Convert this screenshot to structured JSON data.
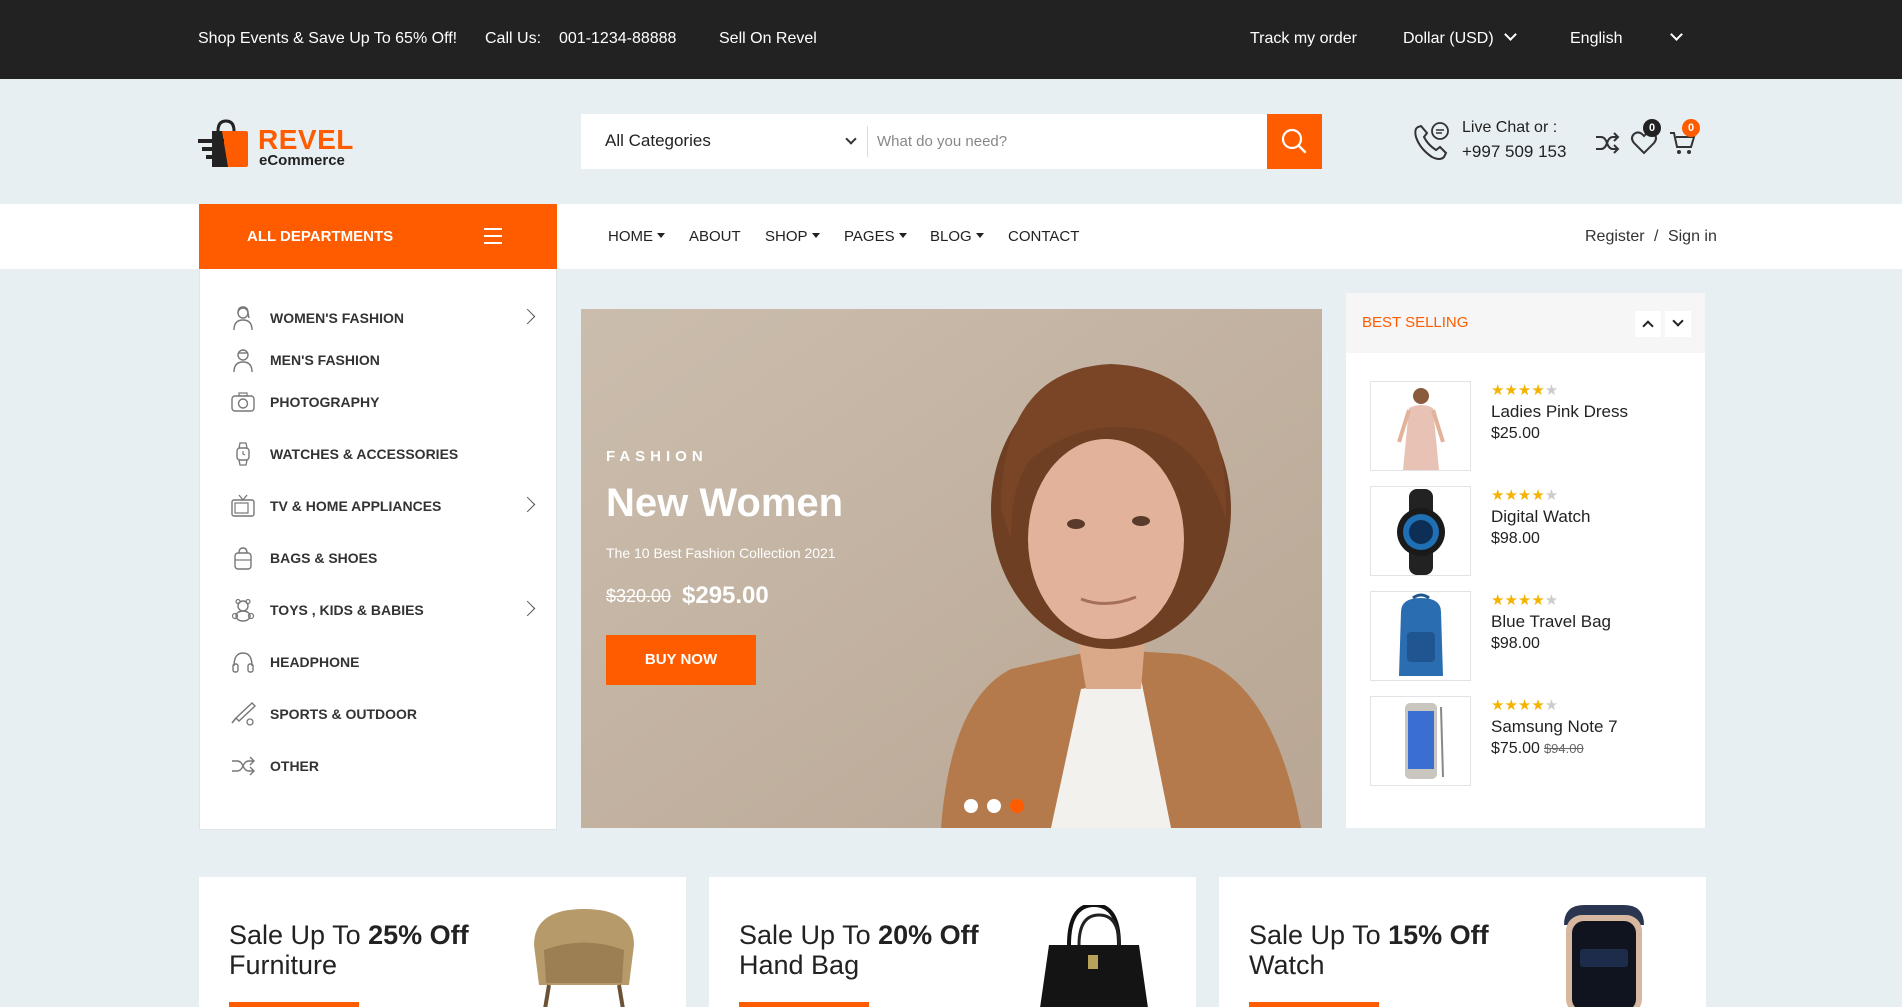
{
  "topbar": {
    "promo": "Shop Events & Save Up To 65% Off!",
    "call_label": "Call Us:",
    "phone": "001-1234-88888",
    "sell": "Sell On Revel",
    "track": "Track my order",
    "currency": "Dollar (USD)",
    "language": "English"
  },
  "logo": {
    "brand": "REVEL",
    "sub": "eCommerce"
  },
  "search": {
    "category": "All Categories",
    "placeholder": "What do you need?"
  },
  "contact": {
    "label": "Live Chat or :",
    "phone": "+997 509 153"
  },
  "header_icons": {
    "wishlist_count": "0",
    "cart_count": "0"
  },
  "nav": {
    "all_departments": "ALL DEPARTMENTS",
    "items": [
      "HOME",
      "ABOUT",
      "SHOP",
      "PAGES",
      "BLOG",
      "CONTACT"
    ],
    "register": "Register",
    "separator": "/",
    "signin": "Sign in"
  },
  "categories": [
    {
      "label": "WOMEN'S FASHION",
      "icon": "woman-icon",
      "has_sub": true
    },
    {
      "label": "MEN'S FASHION",
      "icon": "man-icon",
      "has_sub": false
    },
    {
      "label": "PHOTOGRAPHY",
      "icon": "camera-icon",
      "has_sub": false
    },
    {
      "label": "WATCHES & ACCESSORIES",
      "icon": "watch-icon",
      "has_sub": false
    },
    {
      "label": "TV & HOME APPLIANCES",
      "icon": "tv-icon",
      "has_sub": true
    },
    {
      "label": "BAGS & SHOES",
      "icon": "bag-icon",
      "has_sub": false
    },
    {
      "label": "TOYS , KIDS & BABIES",
      "icon": "teddy-bear-icon",
      "has_sub": true
    },
    {
      "label": "HEADPHONE",
      "icon": "headphone-icon",
      "has_sub": false
    },
    {
      "label": "SPORTS & OUTDOOR",
      "icon": "bat-icon",
      "has_sub": false
    },
    {
      "label": "OTHER",
      "icon": "shuffle-icon",
      "has_sub": false
    }
  ],
  "hero": {
    "kicker": "FASHION",
    "title": "New Women",
    "subtitle": "The 10 Best Fashion Collection 2021",
    "old_price": "$320.00",
    "new_price": "$295.00",
    "button": "BUY NOW",
    "active_slide": 3,
    "slides": 3
  },
  "best_selling": {
    "title": "BEST SELLING",
    "products": [
      {
        "name": "Ladies Pink Dress",
        "price": "$25.00",
        "old_price": "",
        "rating": 4
      },
      {
        "name": "Digital Watch",
        "price": "$98.00",
        "old_price": "",
        "rating": 4
      },
      {
        "name": "Blue Travel Bag",
        "price": "$98.00",
        "old_price": "",
        "rating": 4
      },
      {
        "name": "Samsung Note 7",
        "price": "$75.00",
        "old_price": "$94.00",
        "rating": 4
      }
    ]
  },
  "promos": [
    {
      "prefix": "Sale Up To",
      "discount": "25% Off",
      "item": "Furniture"
    },
    {
      "prefix": "Sale Up To",
      "discount": "20% Off",
      "item": "Hand Bag"
    },
    {
      "prefix": "Sale Up To",
      "discount": "15% Off",
      "item": "Watch"
    }
  ],
  "colors": {
    "accent": "#ff5c00",
    "dark": "#222222",
    "background": "#e8eff3",
    "star": "#f5b301"
  }
}
